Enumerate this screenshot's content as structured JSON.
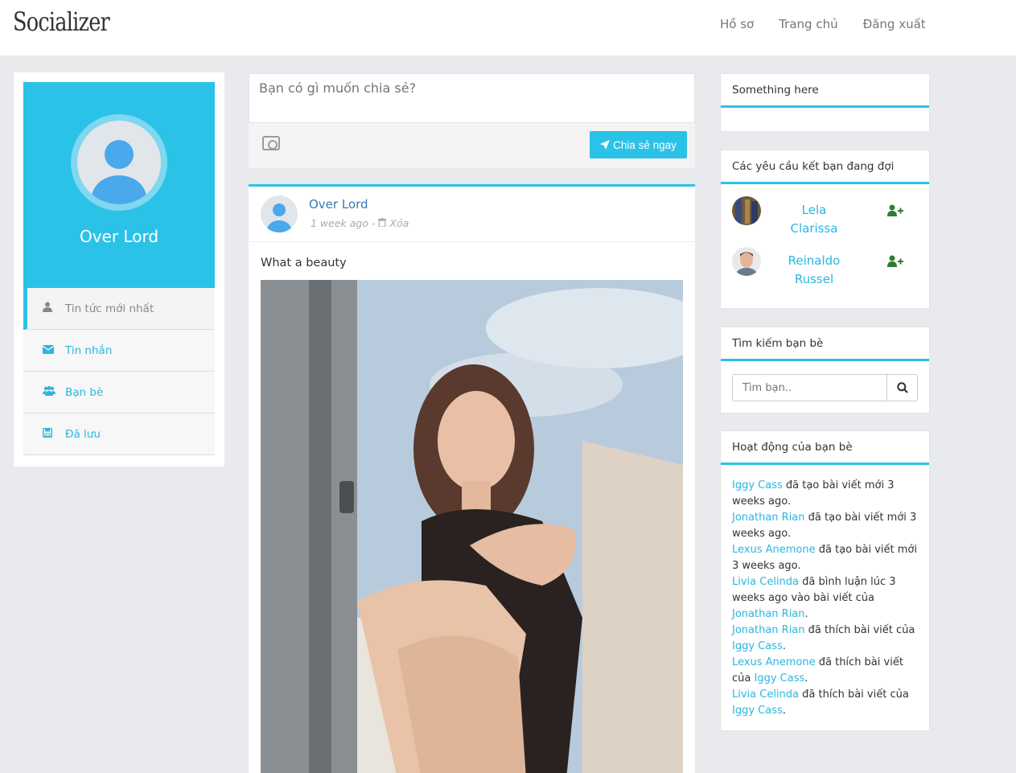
{
  "nav": {
    "brand": "Socializer",
    "links": [
      "Hồ sơ",
      "Trang chủ",
      "Đăng xuất"
    ]
  },
  "profile": {
    "name": "Over Lord"
  },
  "menu": [
    {
      "label": "Tin tức mới nhất",
      "icon": "user-icon"
    },
    {
      "label": "Tin nhắn",
      "icon": "envelope-icon"
    },
    {
      "label": "Bạn bè",
      "icon": "users-icon"
    },
    {
      "label": "Đã lưu",
      "icon": "save-icon"
    }
  ],
  "share": {
    "placeholder": "Bạn có gì muốn chia sẻ?",
    "button_label": "Chia sẻ ngay"
  },
  "post": {
    "author": "Over Lord",
    "time": "1 week ago -",
    "delete_label": "Xóa",
    "text": "What a beauty"
  },
  "widgets": {
    "something": {
      "title": "Something here"
    },
    "requests": {
      "title": "Các yêu cầu kết bạn đang đợi",
      "items": [
        {
          "name_line1": "Lela",
          "name_line2": "Clarissa"
        },
        {
          "name_line1": "Reinaldo",
          "name_line2": "Russel"
        }
      ]
    },
    "search": {
      "title": "Tìm kiếm bạn bè",
      "placeholder": "Tìm bạn.."
    },
    "activity": {
      "title": "Hoạt động của bạn bè",
      "lines": [
        {
          "user": "Iggy Cass",
          "text": " đã tạo bài viết mới 3 weeks ago."
        },
        {
          "user": "Jonathan Rian",
          "text": " đã tạo bài viết mới 3 weeks ago."
        },
        {
          "user": "Lexus Anemone",
          "text": " đã tạo bài viết mới 3 weeks ago."
        },
        {
          "user": "Livia Celinda",
          "text": " đã bình luận lúc 3 weeks ago vào bài viết của ",
          "target": "Jonathan Rian",
          "end": "."
        },
        {
          "user": "Jonathan Rian",
          "text": " đã thích bài viết của ",
          "target": "Iggy Cass",
          "end": "."
        },
        {
          "user": "Lexus Anemone",
          "text": " đã thích bài viết của ",
          "target": "Iggy Cass",
          "end": "."
        },
        {
          "user": "Livia Celinda",
          "text": " đã thích bài viết của ",
          "target": "Iggy Cass",
          "end": "."
        }
      ]
    }
  },
  "colors": {
    "accent": "#2bc2e8",
    "link": "#2bb6e0",
    "author_link": "#337ab7",
    "add_friend": "#2e7d32"
  }
}
